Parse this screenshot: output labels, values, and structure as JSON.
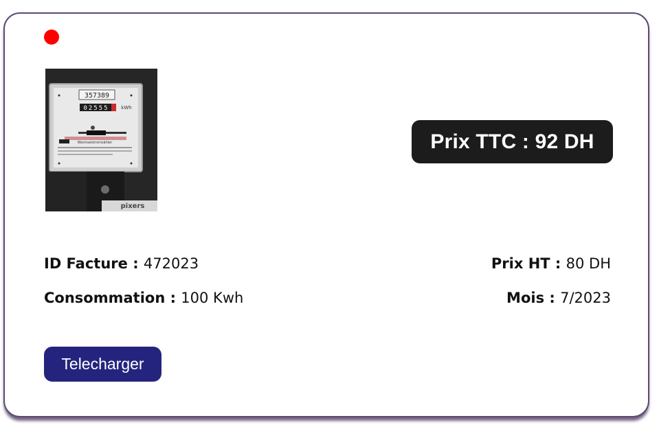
{
  "card": {
    "status_color": "#ff0000",
    "image": {
      "meter_serial": "357389",
      "meter_reading": "02555",
      "meter_unit": "kWh",
      "meter_plate": "Wechselstromzähler",
      "watermark": "pixers"
    },
    "price_ttc": {
      "label": "Prix TTC",
      "separator": " : ",
      "value": "92 DH"
    },
    "fields": {
      "id_facture": {
        "label": "ID Facture",
        "separator": " : ",
        "value": "472023"
      },
      "consommation": {
        "label": "Consommation",
        "separator": " : ",
        "value": "100 Kwh"
      },
      "prix_ht": {
        "label": "Prix HT",
        "separator": " : ",
        "value": "80 DH"
      },
      "mois": {
        "label": "Mois",
        "separator": " : ",
        "value": "7/2023"
      }
    },
    "download_label": "Telecharger"
  },
  "colors": {
    "badge_bg": "#1c1c1c",
    "button_bg": "#24247e",
    "card_border": "#5a4a72"
  }
}
